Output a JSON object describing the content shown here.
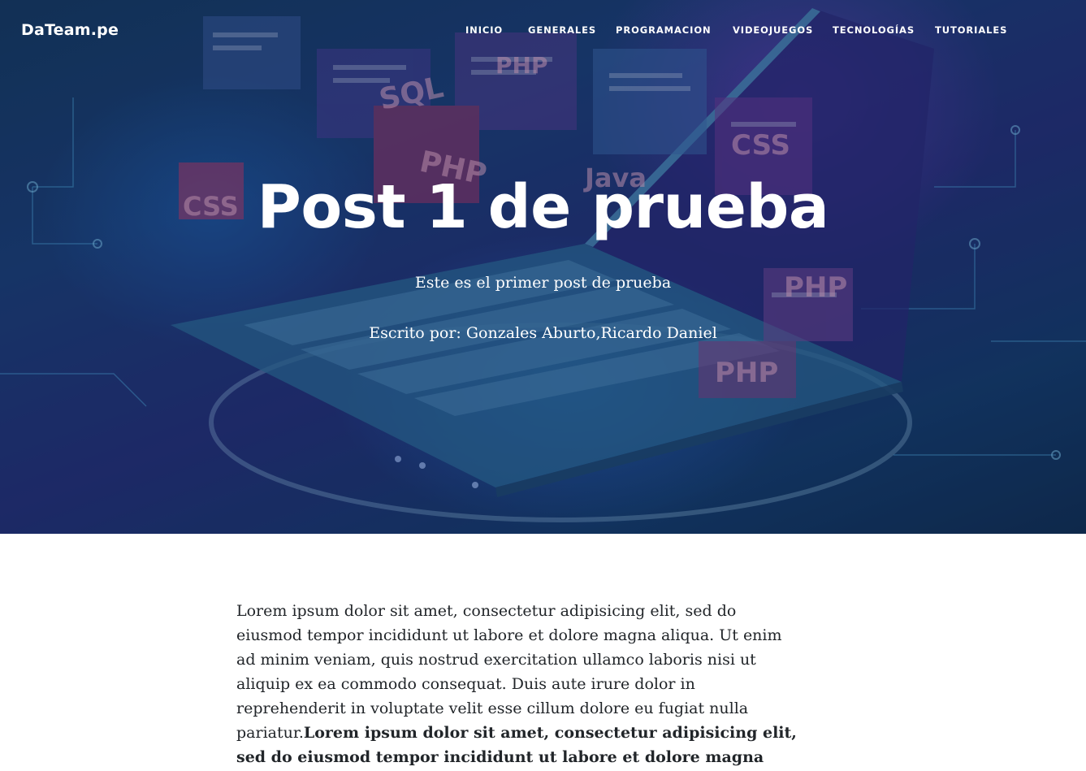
{
  "navbar": {
    "brand": "DaTeam.pe",
    "links": [
      {
        "label": "INICIO"
      },
      {
        "label": "GENERALES"
      },
      {
        "label": "PROGRAMACION"
      },
      {
        "label": "VIDEOJUEGOS"
      },
      {
        "label": "TECNOLOGÍAS"
      },
      {
        "label": "TUTORIALES"
      }
    ]
  },
  "hero": {
    "title": "Post 1 de prueba",
    "subtitle": "Este es el primer post de prueba",
    "meta": "Escrito por: Gonzales Aburto,Ricardo Daniel",
    "image_labels": [
      "SQL",
      "PHP",
      "CSS",
      "CSS",
      "Java",
      "PHP",
      "PHP",
      "PHP"
    ]
  },
  "article": {
    "text_regular": "Lorem ipsum dolor sit amet, consectetur adipisicing elit, sed do eiusmod tempor incididunt ut labore et dolore magna aliqua. Ut enim ad minim veniam, quis nostrud exercitation ullamco laboris nisi ut aliquip ex ea commodo consequat. Duis aute irure dolor in reprehenderit in voluptate velit esse cillum dolore eu fugiat nulla pariatur.",
    "text_bold": "Lorem ipsum dolor sit amet, consectetur adipisicing elit, sed do eiusmod tempor incididunt ut labore et dolore magna aliqua. Ut enim ad minim veniam, quis nostrud"
  },
  "colors": {
    "hero_dark": "#143a63",
    "hero_purple": "#23307a",
    "accent_pink": "#e0457a",
    "text_dark": "#212529",
    "white": "#ffffff"
  }
}
